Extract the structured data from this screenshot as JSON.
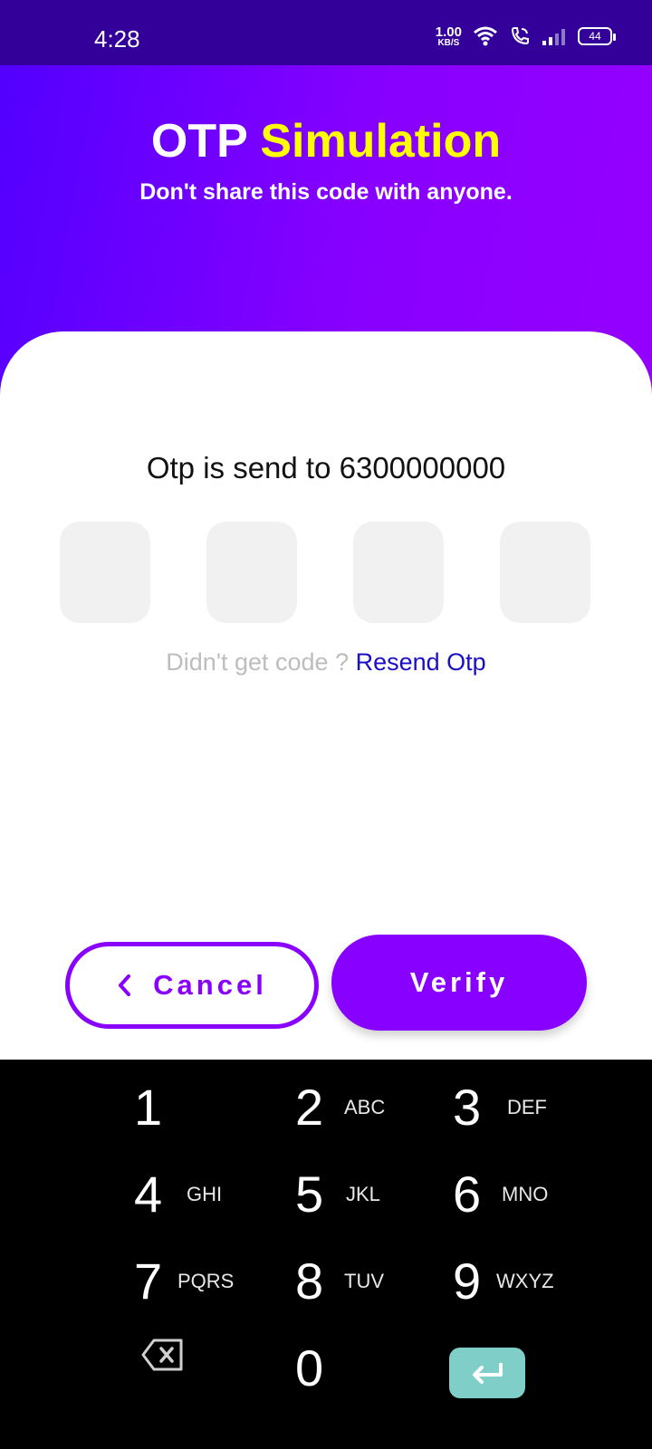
{
  "status_bar": {
    "time": "4:28",
    "net_speed_value": "1.00",
    "net_speed_unit": "KB/S",
    "battery": "44"
  },
  "header": {
    "title_main": "OTP",
    "title_accent": "Simulation",
    "subtitle": "Don't share this code with anyone."
  },
  "otp": {
    "message": "Otp is send to 6300000000",
    "digits": [
      "",
      "",
      "",
      ""
    ],
    "resend_prompt": "Didn't get code ?",
    "resend_link": "Resend Otp"
  },
  "actions": {
    "cancel_label": "Cancel",
    "verify_label": "Verify"
  },
  "keypad": {
    "keys": [
      {
        "num": "1",
        "letters": ""
      },
      {
        "num": "2",
        "letters": "ABC"
      },
      {
        "num": "3",
        "letters": "DEF"
      },
      {
        "num": "4",
        "letters": "GHI"
      },
      {
        "num": "5",
        "letters": "JKL"
      },
      {
        "num": "6",
        "letters": "MNO"
      },
      {
        "num": "7",
        "letters": "PQRS"
      },
      {
        "num": "8",
        "letters": "TUV"
      },
      {
        "num": "9",
        "letters": "WXYZ"
      },
      {
        "num": "0",
        "letters": ""
      }
    ],
    "backspace_icon": "backspace-icon",
    "enter_icon": "enter-icon"
  },
  "colors": {
    "status_bar": "#330099",
    "gradient_start": "#5200ff",
    "gradient_end": "#9500ff",
    "accent_yellow": "#ffff00",
    "primary_purple": "#8800ff",
    "link_blue": "#1a0fc7",
    "enter_key": "#7fcfc8"
  }
}
